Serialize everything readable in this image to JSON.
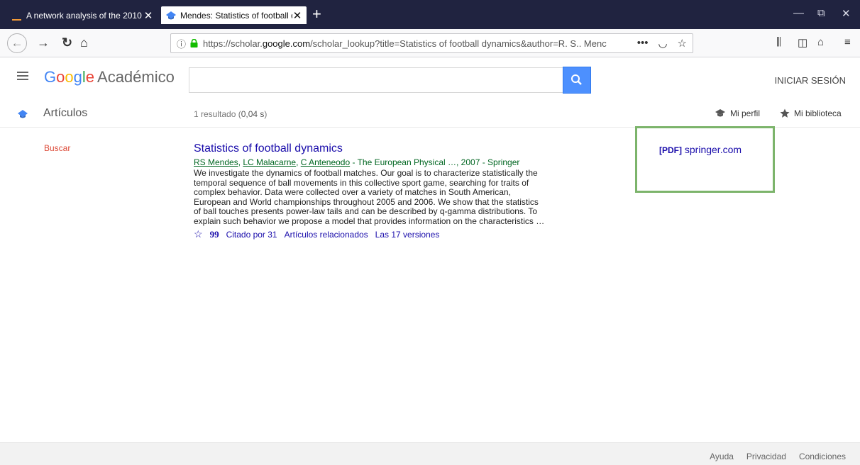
{
  "browser": {
    "tabs": [
      {
        "label": "A network analysis of the 2010",
        "active": false
      },
      {
        "label": "Mendes: Statistics of football d",
        "active": true
      }
    ],
    "tab_close": "✕",
    "new_tab": "+",
    "window_controls": {
      "minimize": "—",
      "restore": "⧉",
      "close": "✕"
    },
    "url": {
      "prefix": "https://scholar.",
      "domain": "google.com",
      "rest": "/scholar_lookup?title=Statistics of football dynamics&author=R. S.. Menc"
    },
    "url_actions": {
      "more": "•••",
      "pocket": "◡",
      "bookmark": "☆"
    }
  },
  "header": {
    "logo_letters": [
      "G",
      "o",
      "o",
      "g",
      "l",
      "e"
    ],
    "logo_suffix": "Académico",
    "search": {
      "value": "",
      "placeholder": ""
    },
    "signin": "INICIAR SESIÓN"
  },
  "subheader": {
    "section": "Artículos",
    "result_count_prefix": "1 resultado (",
    "result_count_time": "0,04 s",
    "result_count_suffix": ")",
    "profile": "Mi perfil",
    "library": "Mi biblioteca"
  },
  "sidebar": {
    "search_link": "Buscar"
  },
  "result": {
    "title": "Statistics of football dynamics",
    "authors": [
      "RS Mendes",
      "LC Malacarne",
      "C Anteneodo"
    ],
    "source": " - The European Physical …, 2007 - Springer",
    "snippet_lines": [
      "We investigate the dynamics of football matches. Our goal is to characterize statistically the",
      "temporal sequence of ball movements in this collective sport game, searching for traits of",
      "complex behavior. Data were collected over a variety of matches in South American,",
      "European and World championships throughout 2005 and 2006. We show that the statistics",
      "of ball touches presents power-law tails and can be described by q-gamma distributions. To",
      "explain such behavior we propose a model that provides information on the characteristics …"
    ],
    "actions": {
      "cited_by": "Citado por 31",
      "related": "Artículos relacionados",
      "versions": "Las 17 versiones"
    },
    "pdf": {
      "tag": "[PDF]",
      "host": "springer.com"
    }
  },
  "footer": {
    "links": [
      "Ayuda",
      "Privacidad",
      "Condiciones"
    ]
  },
  "colors": {
    "tabbar": "#202340",
    "link": "#1a0dab",
    "green": "#006621",
    "search_button": "#4d90fe",
    "highlight": "#7cb46b"
  }
}
